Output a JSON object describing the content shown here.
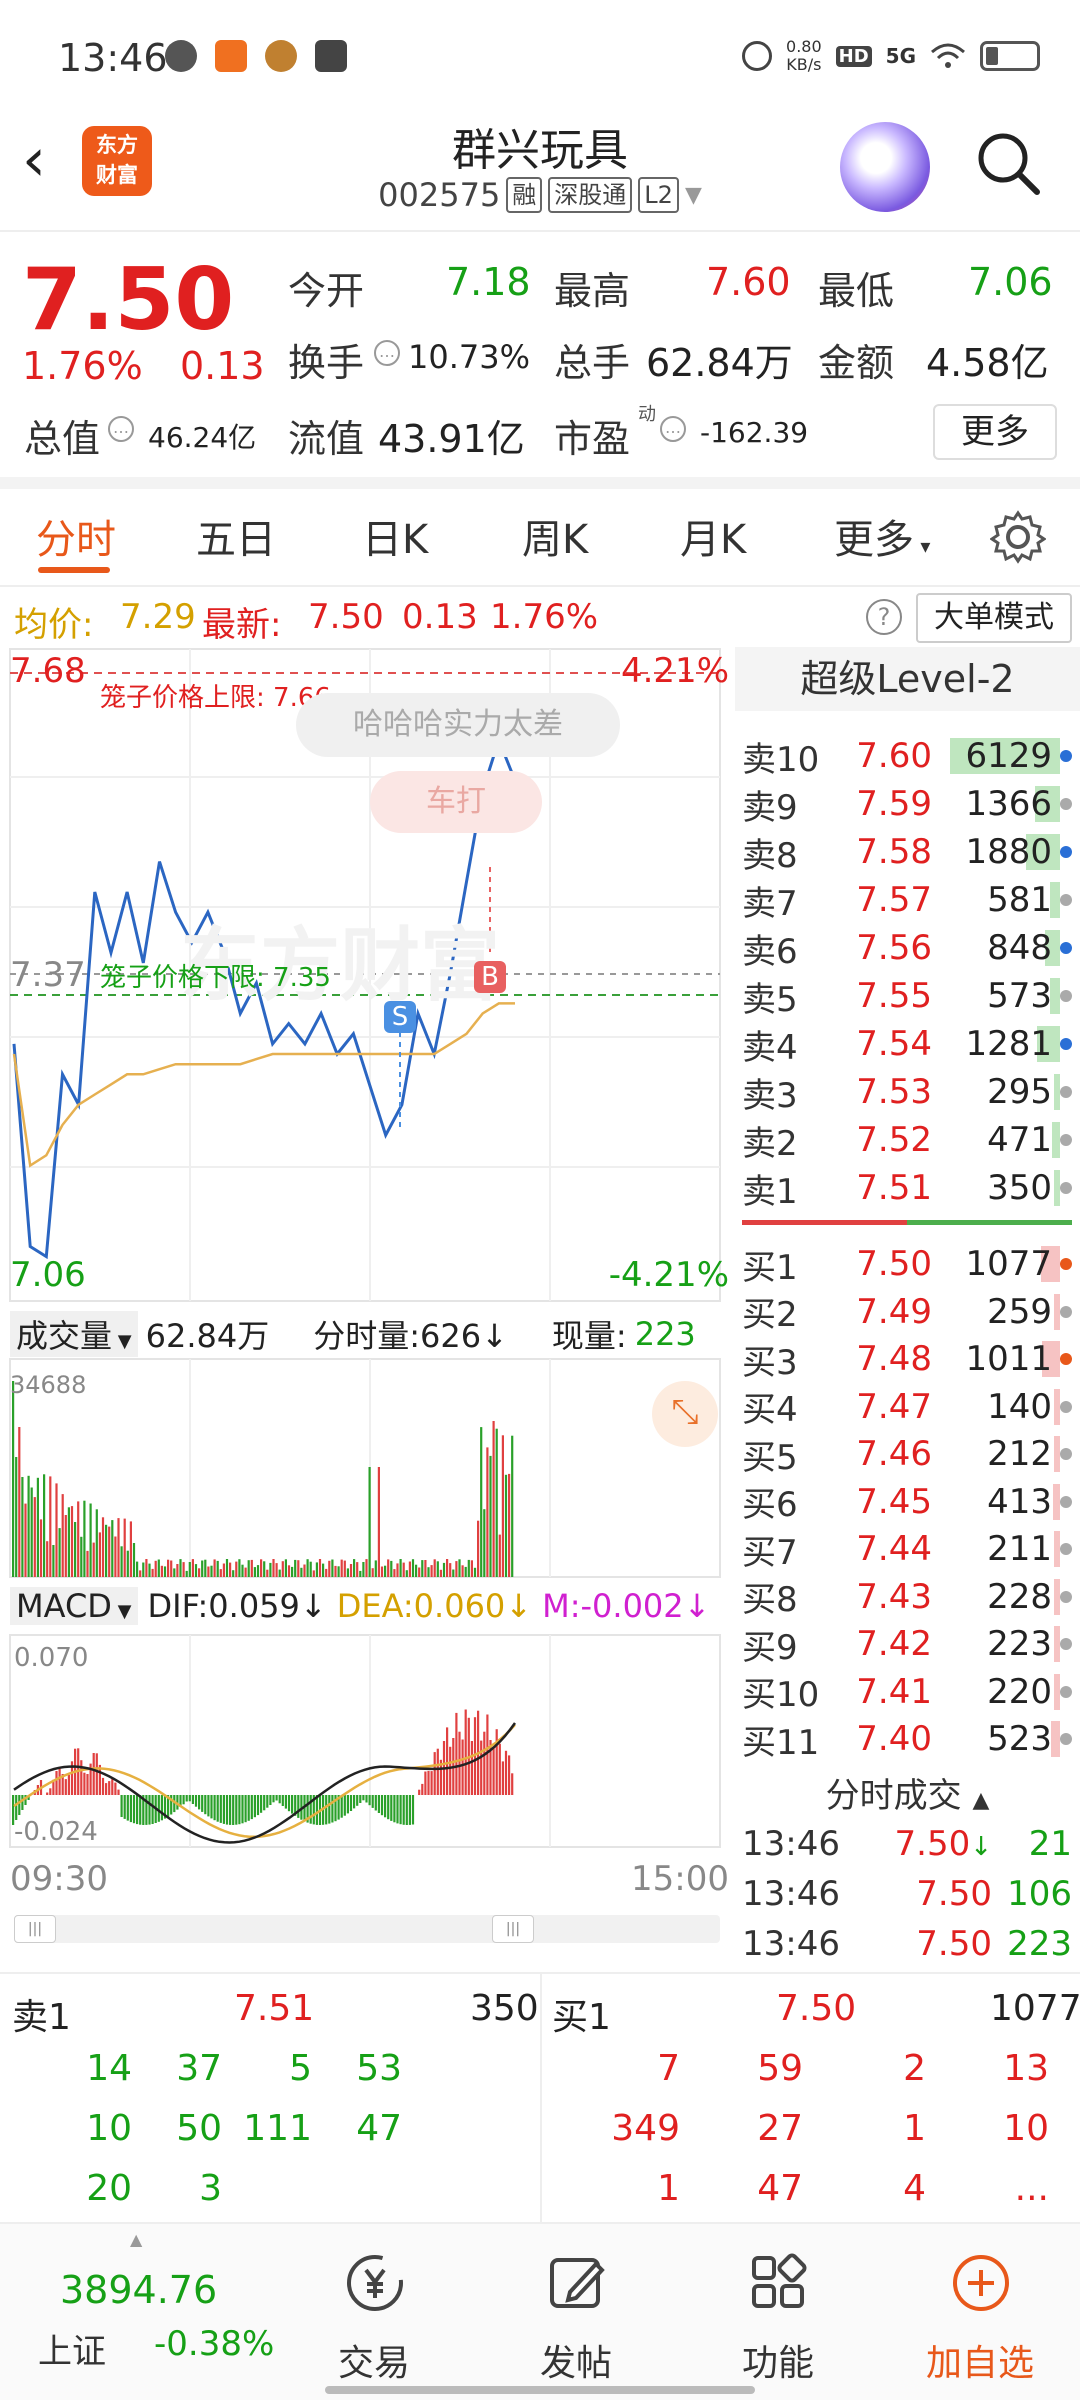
{
  "status_bar": {
    "time": "13:46",
    "net_speed_value": "0.80",
    "net_speed_unit": "KB/s",
    "hd": "HD",
    "signal": "5G"
  },
  "header": {
    "logo_line1": "东方",
    "logo_line2": "财富",
    "title": "群兴玩具",
    "code": "002575",
    "tags": [
      "融",
      "深股通",
      "L2"
    ]
  },
  "quote": {
    "price": "7.50",
    "change_pct": "1.76%",
    "change": "0.13",
    "open_label": "今开",
    "open": "7.18",
    "high_label": "最高",
    "high": "7.60",
    "low_label": "最低",
    "low": "7.06",
    "turnover_label": "换手",
    "turnover": "10.73%",
    "volume_label": "总手",
    "volume": "62.84万",
    "amount_label": "金额",
    "amount": "4.58亿",
    "mktcap_label": "总值",
    "mktcap": "46.24亿",
    "float_label": "流值",
    "float": "43.91亿",
    "pe_label": "市盈",
    "pe_sup": "动",
    "pe": "-162.39",
    "more": "更多"
  },
  "tabs": [
    {
      "label": "分时"
    },
    {
      "label": "五日"
    },
    {
      "label": "日K"
    },
    {
      "label": "周K"
    },
    {
      "label": "月K"
    },
    {
      "label": "更多"
    }
  ],
  "info": {
    "avg_label": "均价:",
    "avg": "7.29",
    "latest_label": "最新:",
    "latest": "7.50",
    "chg": "0.13",
    "pct": "1.76%",
    "big_order": "大单模式"
  },
  "chart": {
    "top_price": "7.68",
    "top_pct": "4.21%",
    "bottom_price": "7.06",
    "bottom_pct": "-4.21%",
    "mid_price": "7.37",
    "upper_limit": "笼子价格上限: 7.66",
    "lower_limit": "笼子价格下限: 7.35",
    "bubble1": "哈哈哈实力太差",
    "bubble2": "车打",
    "watermark": "东方财富",
    "s_marker": "S",
    "b_marker": "B",
    "vol_label": "成交量",
    "vol_total": "62.84万",
    "vol_min_label": "分时量:626",
    "vol_now_label": "现量:",
    "vol_now": "223",
    "vol_max": "34688",
    "macd_label": "MACD",
    "dif": "DIF:0.059",
    "dea": "DEA:0.060",
    "m": "M:-0.002",
    "macd_top": "0.070",
    "macd_bot": "-0.024",
    "time_start": "09:30",
    "time_end": "15:00"
  },
  "chart_data": {
    "type": "line",
    "title": "",
    "x": [
      "09:30",
      "15:00"
    ],
    "ylim": [
      7.06,
      7.68
    ],
    "series": [
      {
        "name": "",
        "color": "#2b66c2",
        "values": [
          7.3,
          7.1,
          7.09,
          7.27,
          7.24,
          7.45,
          7.39,
          7.45,
          7.38,
          7.48,
          7.43,
          7.4,
          7.43,
          7.39,
          7.33,
          7.36,
          7.3,
          7.32,
          7.3,
          7.33,
          7.29,
          7.31,
          7.26,
          7.21,
          7.24,
          7.33,
          7.29,
          7.37,
          7.46,
          7.55,
          7.6,
          7.56
        ]
      },
      {
        "name": "",
        "color": "#e6b050",
        "values": [
          7.29,
          7.18,
          7.19,
          7.22,
          7.24,
          7.25,
          7.26,
          7.27,
          7.27,
          7.275,
          7.28,
          7.28,
          7.28,
          7.28,
          7.28,
          7.285,
          7.29,
          7.29,
          7.29,
          7.29,
          7.29,
          7.29,
          7.29,
          7.29,
          7.29,
          7.29,
          7.29,
          7.3,
          7.31,
          7.33,
          7.34,
          7.34
        ]
      }
    ]
  },
  "level2": {
    "title": "超级Level-2",
    "asks": [
      {
        "label": "卖10",
        "price": "7.60",
        "qty": "6129"
      },
      {
        "label": "卖9",
        "price": "7.59",
        "qty": "1366"
      },
      {
        "label": "卖8",
        "price": "7.58",
        "qty": "1880"
      },
      {
        "label": "卖7",
        "price": "7.57",
        "qty": "581"
      },
      {
        "label": "卖6",
        "price": "7.56",
        "qty": "848"
      },
      {
        "label": "卖5",
        "price": "7.55",
        "qty": "573"
      },
      {
        "label": "卖4",
        "price": "7.54",
        "qty": "1281"
      },
      {
        "label": "卖3",
        "price": "7.53",
        "qty": "295"
      },
      {
        "label": "卖2",
        "price": "7.52",
        "qty": "471"
      },
      {
        "label": "卖1",
        "price": "7.51",
        "qty": "350"
      }
    ],
    "bids": [
      {
        "label": "买1",
        "price": "7.50",
        "qty": "1077"
      },
      {
        "label": "买2",
        "price": "7.49",
        "qty": "259"
      },
      {
        "label": "买3",
        "price": "7.48",
        "qty": "1011"
      },
      {
        "label": "买4",
        "price": "7.47",
        "qty": "140"
      },
      {
        "label": "买5",
        "price": "7.46",
        "qty": "212"
      },
      {
        "label": "买6",
        "price": "7.45",
        "qty": "413"
      },
      {
        "label": "买7",
        "price": "7.44",
        "qty": "211"
      },
      {
        "label": "买8",
        "price": "7.43",
        "qty": "228"
      },
      {
        "label": "买9",
        "price": "7.42",
        "qty": "223"
      },
      {
        "label": "买10",
        "price": "7.41",
        "qty": "220"
      },
      {
        "label": "买11",
        "price": "7.40",
        "qty": "523"
      }
    ],
    "trades_title": "分时成交",
    "trades": [
      {
        "time": "13:46",
        "price": "7.50",
        "arrow": "↓",
        "vol": "21"
      },
      {
        "time": "13:46",
        "price": "7.50",
        "arrow": "",
        "vol": "106"
      },
      {
        "time": "13:46",
        "price": "7.50",
        "arrow": "",
        "vol": "223"
      }
    ]
  },
  "detail": {
    "ask_label": "卖1",
    "ask_price": "7.51",
    "ask_qty": "350",
    "bid_label": "买1",
    "bid_price": "7.50",
    "bid_qty": "1077",
    "ask_rows": [
      [
        "14",
        "37",
        "5",
        "53"
      ],
      [
        "10",
        "50",
        "111",
        "47"
      ],
      [
        "20",
        "3",
        "",
        ""
      ]
    ],
    "bid_rows": [
      [
        "7",
        "59",
        "2",
        "13"
      ],
      [
        "349",
        "27",
        "1",
        "10"
      ],
      [
        "1",
        "47",
        "4",
        "..."
      ]
    ]
  },
  "nav": {
    "index_value": "3894.76",
    "index_name": "上证",
    "index_chg": "-0.38%",
    "items": [
      {
        "label": "交易"
      },
      {
        "label": "发帖"
      },
      {
        "label": "功能"
      },
      {
        "label": "加自选"
      }
    ]
  }
}
